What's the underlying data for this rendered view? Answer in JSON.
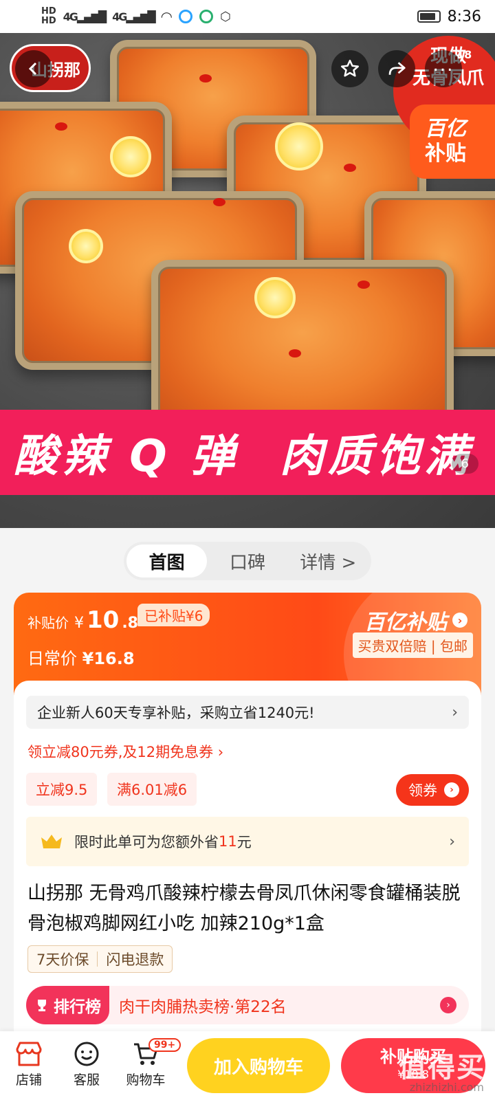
{
  "status_bar": {
    "time": "8:36",
    "signal_1": "4G",
    "signal_2": "4G"
  },
  "hero": {
    "brand_logo": "山拐那",
    "sticker_line1": "现做",
    "sticker_line2": "无骨凤爪",
    "cart_count": "18",
    "subsidy_tag_line1": "百亿",
    "subsidy_tag_line2": "补贴",
    "banner_left": "酸辣 Q 弹",
    "banner_right": "肉质饱满",
    "image_counter": "6"
  },
  "tabs": [
    {
      "label": "首图",
      "active": true
    },
    {
      "label": "口碑",
      "active": false
    },
    {
      "label": "详情 >",
      "active": false
    }
  ],
  "price": {
    "subsidy_label": "补贴价",
    "currency": "¥",
    "subsidy_price_int": "10",
    "subsidy_price_dec": ".8",
    "subsidized_chip": "已补贴¥6",
    "daily_label": "日常价",
    "daily_price": "¥16.8",
    "program_name": "百亿补贴",
    "guarantee": "买贵双倍赔 | 包邮"
  },
  "promo": {
    "notice": "企业新人60天专享补贴，采购立省1240元!",
    "coupon_link": "领立减80元券,及12期免息券 ›",
    "chip_1": "立减9.5",
    "chip_2": "满6.01减6",
    "get_coupon": "领券",
    "vip_text_prefix": "限时此单可为您额外省",
    "vip_amount": "11",
    "vip_unit": "元"
  },
  "product": {
    "title": "山拐那 无骨鸡爪酸辣柠檬去骨凤爪休闲零食罐桶装脱骨泡椒鸡脚网红小吃 加辣210g*1盒",
    "tag_1": "7天价保",
    "tag_2": "闪电退款",
    "rank_badge": "排行榜",
    "rank_text": "肉干肉脯热卖榜·第22名"
  },
  "bottom_bar": {
    "store": "店铺",
    "service": "客服",
    "cart": "购物车",
    "cart_badge": "99+",
    "add_to_cart": "加入购物车",
    "buy_label": "补贴购买",
    "buy_price": "¥10.8"
  },
  "watermark": {
    "main": "值得买",
    "sub": "zhizhizhi.com"
  },
  "colors": {
    "accent": "#ff4a17",
    "pink": "#f21f5a",
    "yellow": "#ffd21f"
  }
}
